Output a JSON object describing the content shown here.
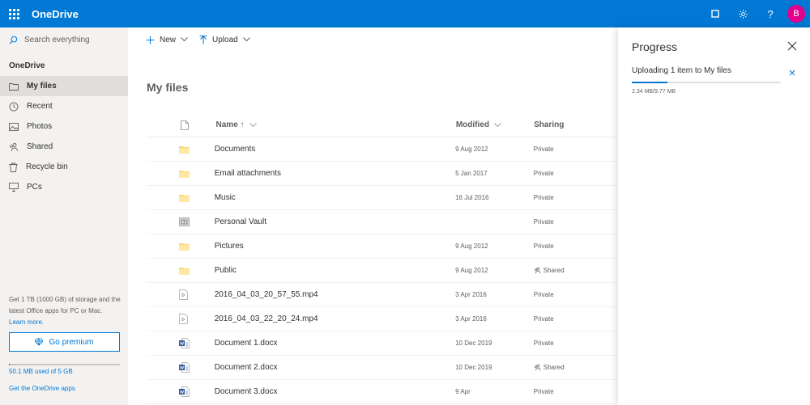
{
  "app": {
    "brand": "OneDrive",
    "avatar_initial": "B",
    "accent": "#0078d4",
    "avatar_color": "#e3008c"
  },
  "sidebar": {
    "search_placeholder": "Search everything",
    "section": "OneDrive",
    "items": [
      {
        "label": "My files",
        "icon": "folder-icon",
        "active": true
      },
      {
        "label": "Recent",
        "icon": "clock-icon",
        "active": false
      },
      {
        "label": "Photos",
        "icon": "photo-icon",
        "active": false
      },
      {
        "label": "Shared",
        "icon": "people-icon",
        "active": false
      },
      {
        "label": "Recycle bin",
        "icon": "trash-icon",
        "active": false
      },
      {
        "label": "PCs",
        "icon": "pc-icon",
        "active": false
      }
    ],
    "promo_text": "Get 1 TB (1000 GB) of storage and the latest Office apps for PC or Mac.",
    "promo_link": "Learn more.",
    "premium_label": "Go premium",
    "storage_text": "50.1 MB used of 5 GB",
    "storage_fraction": 0.01,
    "apps_link": "Get the OneDrive apps"
  },
  "commands": {
    "new": "New",
    "upload": "Upload"
  },
  "page_title": "My files",
  "table": {
    "headers": {
      "name": "Name ↑",
      "modified": "Modified",
      "sharing": "Sharing"
    },
    "rows": [
      {
        "type": "folder",
        "name": "Documents",
        "modified": "9 Aug 2012",
        "sharing": "Private"
      },
      {
        "type": "folder",
        "name": "Email attachments",
        "modified": "5 Jan 2017",
        "sharing": "Private"
      },
      {
        "type": "folder",
        "name": "Music",
        "modified": "16 Jul 2016",
        "sharing": "Private"
      },
      {
        "type": "vault",
        "name": "Personal Vault",
        "modified": "",
        "sharing": "Private"
      },
      {
        "type": "folder",
        "name": "Pictures",
        "modified": "9 Aug 2012",
        "sharing": "Private"
      },
      {
        "type": "folder",
        "name": "Public",
        "modified": "9 Aug 2012",
        "sharing": "Shared"
      },
      {
        "type": "video",
        "name": "2016_04_03_20_57_55.mp4",
        "modified": "3 Apr 2016",
        "sharing": "Private"
      },
      {
        "type": "video",
        "name": "2016_04_03_22_20_24.mp4",
        "modified": "3 Apr 2016",
        "sharing": "Private"
      },
      {
        "type": "word",
        "name": "Document 1.docx",
        "modified": "10 Dec 2019",
        "sharing": "Private"
      },
      {
        "type": "word",
        "name": "Document 2.docx",
        "modified": "10 Dec 2019",
        "sharing": "Shared"
      },
      {
        "type": "word",
        "name": "Document 3.docx",
        "modified": "9 Apr",
        "sharing": "Private"
      }
    ]
  },
  "progress": {
    "title": "Progress",
    "status": "Uploading 1 item to My files",
    "size": "2.34 MB/9.77 MB",
    "fraction": 0.24
  }
}
